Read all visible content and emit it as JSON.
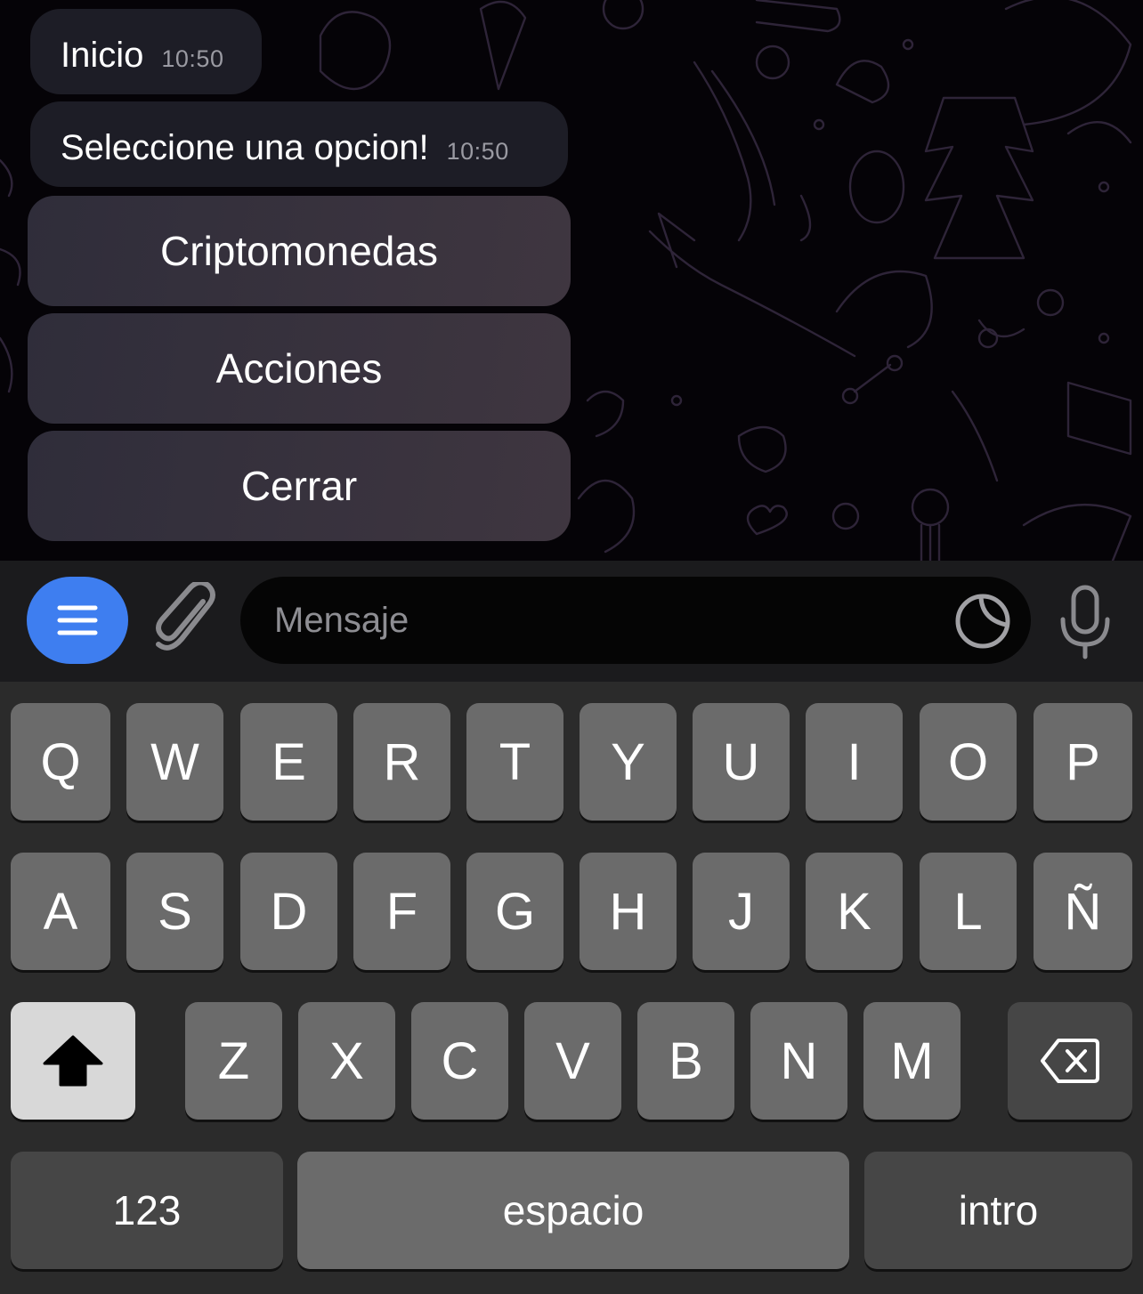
{
  "chat": {
    "messages": [
      {
        "text": "Inicio",
        "time": "10:50"
      },
      {
        "text": "Seleccione una opcion!",
        "time": "10:50"
      }
    ],
    "inline_buttons": [
      "Criptomonedas",
      "Acciones",
      "Cerrar"
    ]
  },
  "input_bar": {
    "menu_icon": "menu-lines-icon",
    "attach_icon": "paperclip-icon",
    "placeholder": "Mensaje",
    "sticker_icon": "sticker-icon",
    "mic_icon": "microphone-icon",
    "accent_color": "#3e7ef0"
  },
  "keyboard": {
    "row1": [
      "Q",
      "W",
      "E",
      "R",
      "T",
      "Y",
      "U",
      "I",
      "O",
      "P"
    ],
    "row2": [
      "A",
      "S",
      "D",
      "F",
      "G",
      "H",
      "J",
      "K",
      "L",
      "Ñ"
    ],
    "row3": [
      "Z",
      "X",
      "C",
      "V",
      "B",
      "N",
      "M"
    ],
    "shift_icon": "shift-arrow-icon",
    "backspace_icon": "backspace-icon",
    "numbers_label": "123",
    "space_label": "espacio",
    "return_label": "intro"
  }
}
